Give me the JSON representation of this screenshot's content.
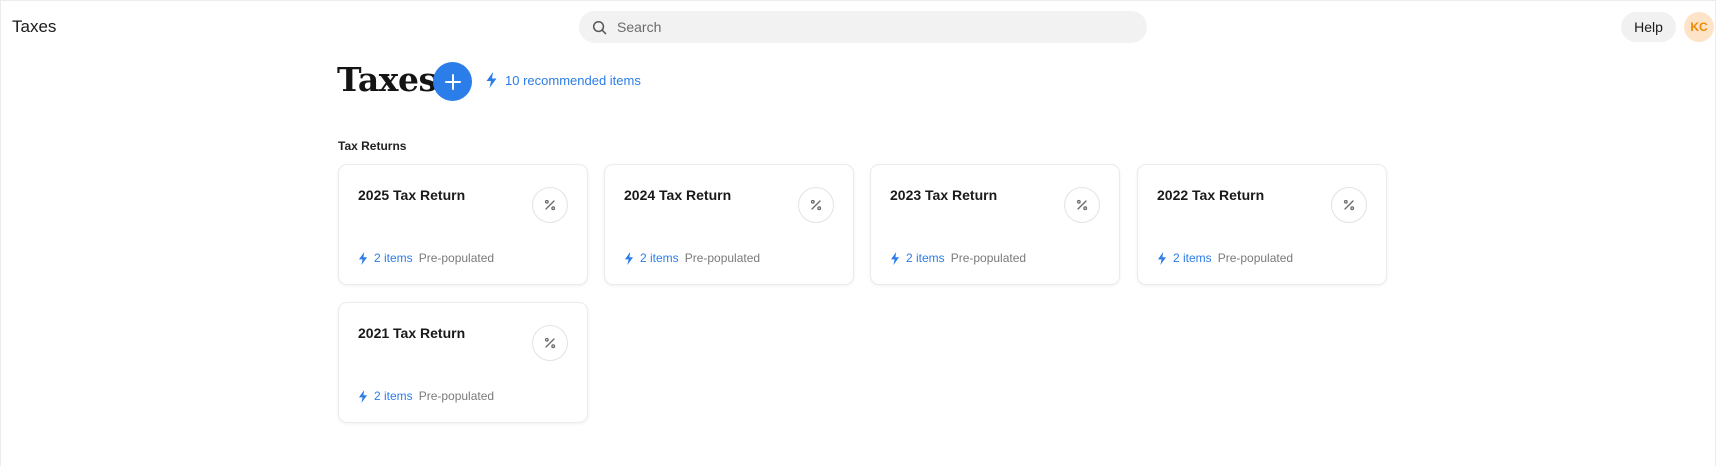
{
  "app": {
    "title": "Taxes"
  },
  "search": {
    "placeholder": "Search",
    "icon": "search-icon"
  },
  "header_actions": {
    "help_label": "Help",
    "avatar_initials": "KC",
    "avatar_bg": "#fde4c8",
    "avatar_fg": "#f08a00"
  },
  "page": {
    "title": "Taxes",
    "add_icon": "plus-icon",
    "recommended_label": "10 recommended items",
    "accent": "#2b7de9"
  },
  "section": {
    "label": "Tax Returns"
  },
  "returns": [
    {
      "title": "2025 Tax Return",
      "items": "2 items",
      "status": "Pre-populated",
      "icon": "percent-icon"
    },
    {
      "title": "2024 Tax Return",
      "items": "2 items",
      "status": "Pre-populated",
      "icon": "percent-icon"
    },
    {
      "title": "2023 Tax Return",
      "items": "2 items",
      "status": "Pre-populated",
      "icon": "percent-icon"
    },
    {
      "title": "2022 Tax Return",
      "items": "2 items",
      "status": "Pre-populated",
      "icon": "percent-icon"
    },
    {
      "title": "2021 Tax Return",
      "items": "2 items",
      "status": "Pre-populated",
      "icon": "percent-icon"
    }
  ]
}
